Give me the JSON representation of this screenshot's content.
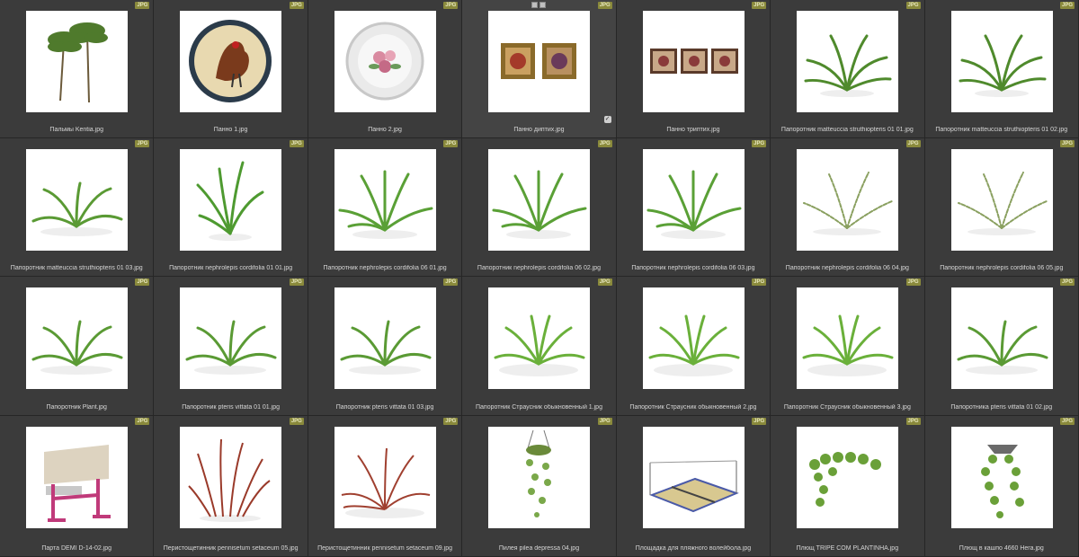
{
  "badge_text": "JPG",
  "colors": {
    "background": "#3b3b3b",
    "label": "#d6d6d6",
    "badge": "#8a8a3c",
    "thumb": "#ffffff"
  },
  "items": [
    {
      "label": "Пальмы Kentia.jpg",
      "kind": "palm"
    },
    {
      "label": "Панно 1.jpg",
      "kind": "plate-rooster"
    },
    {
      "label": "Панно 2.jpg",
      "kind": "plate-floral"
    },
    {
      "label": "Панно диптих.jpg",
      "kind": "diptych",
      "selected": true
    },
    {
      "label": "Панно триптих.jpg",
      "kind": "triptych"
    },
    {
      "label": "Папоротник matteuccia struthiopteris 01 01.jpg",
      "kind": "fern-wide"
    },
    {
      "label": "Папоротник matteuccia struthiopteris 01 02.jpg",
      "kind": "fern-wide"
    },
    {
      "label": "Папоротник matteuccia struthiopteris 01 03.jpg",
      "kind": "fern-low"
    },
    {
      "label": "Папоротник nephrolepis cordifolia 01 01.jpg",
      "kind": "fern-upright"
    },
    {
      "label": "Папоротник nephrolepis cordifolia 06 01.jpg",
      "kind": "fern-bush"
    },
    {
      "label": "Папоротник nephrolepis cordifolia 06 02.jpg",
      "kind": "fern-bush"
    },
    {
      "label": "Папоротник nephrolepis cordifolia 06 03.jpg",
      "kind": "fern-bush"
    },
    {
      "label": "Папоротник nephrolepis cordifolia 06 04.jpg",
      "kind": "fern-sparse"
    },
    {
      "label": "Папоротник nephrolepis cordifolia 06 05.jpg",
      "kind": "fern-sparse"
    },
    {
      "label": "Папоротник Plant.jpg",
      "kind": "fern-low"
    },
    {
      "label": "Папоротник pteris vittata 01 01.jpg",
      "kind": "fern-low"
    },
    {
      "label": "Папоротник pteris vittata 01 03.jpg",
      "kind": "fern-low"
    },
    {
      "label": "Папоротник Страусник обыкновенный 1.jpg",
      "kind": "fern-round"
    },
    {
      "label": "Папоротник Страусник обыкновенный 2.jpg",
      "kind": "fern-round"
    },
    {
      "label": "Папоротник Страусник обыкновенный 3.jpg",
      "kind": "fern-round"
    },
    {
      "label": "Папоротника pteris vittata 01 02.jpg",
      "kind": "fern-low"
    },
    {
      "label": "Парта DEMI D-14-02.jpg",
      "kind": "desk"
    },
    {
      "label": "Перистощетинник pennisetum setaceum 05.jpg",
      "kind": "grass"
    },
    {
      "label": "Перистощетинник pennisetum setaceum 09.jpg",
      "kind": "grass-round"
    },
    {
      "label": "Пилея pilea depressa 04.jpg",
      "kind": "hanging"
    },
    {
      "label": "Площадка для пляжного волейбола.jpg",
      "kind": "court"
    },
    {
      "label": "Плющ TRIPE COM PLANTINHA.jpg",
      "kind": "ivy"
    },
    {
      "label": "Плющ в кашпо 4660 Hera.jpg",
      "kind": "ivy-pot"
    }
  ]
}
